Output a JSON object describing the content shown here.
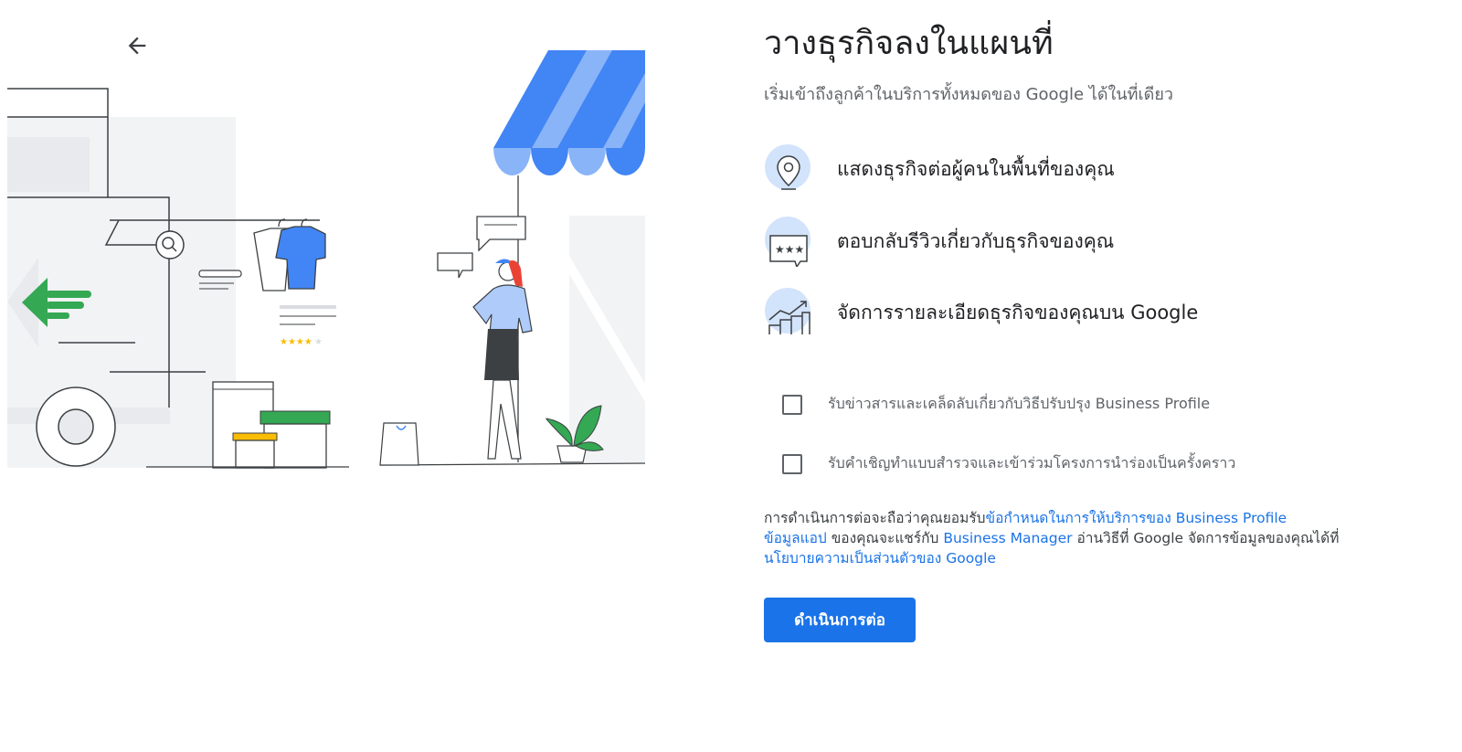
{
  "header": {
    "back_icon": "arrow-back-icon"
  },
  "main": {
    "title": "วางธุรกิจลงในแผนที่",
    "subtitle": "เริ่มเข้าถึงลูกค้าในบริการทั้งหมดของ Google ได้ในที่เดียว",
    "features": [
      {
        "icon": "location-pin-icon",
        "label": "แสดงธุรกิจต่อผู้คนในพื้นที่ของคุณ"
      },
      {
        "icon": "review-stars-icon",
        "label": "ตอบกลับรีวิวเกี่ยวกับธุรกิจของคุณ"
      },
      {
        "icon": "growth-chart-icon",
        "label": "จัดการรายละเอียดธุรกิจของคุณบน Google"
      }
    ],
    "checkboxes": [
      {
        "label": "รับข่าวสารและเคล็ดลับเกี่ยวกับวิธีปรับปรุง Business Profile",
        "checked": false
      },
      {
        "label": "รับคำเชิญทำแบบสำรวจและเข้าร่วมโครงการนำร่องเป็นครั้งคราว",
        "checked": false
      }
    ],
    "legal": {
      "part1": "การดำเนินการต่อจะถือว่าคุณยอมรับ",
      "link_terms": "ข้อกำหนดในการให้บริการของ Business Profile",
      "link_app_data": "ข้อมูลแอป",
      "part2": " ของคุณจะแชร์กับ ",
      "link_business_manager": "Business Manager",
      "part3": " อ่านวิธีที่ Google จัดการข้อมูลของคุณได้ที่",
      "link_privacy": "นโยบายความเป็นส่วนตัวของ Google"
    },
    "continue_label": "ดำเนินการต่อ"
  },
  "colors": {
    "accent": "#1a73e8",
    "awning_blue": "#4285f4",
    "awning_light": "#8ab4f8",
    "green": "#34a853",
    "yellow": "#fbbc04"
  }
}
